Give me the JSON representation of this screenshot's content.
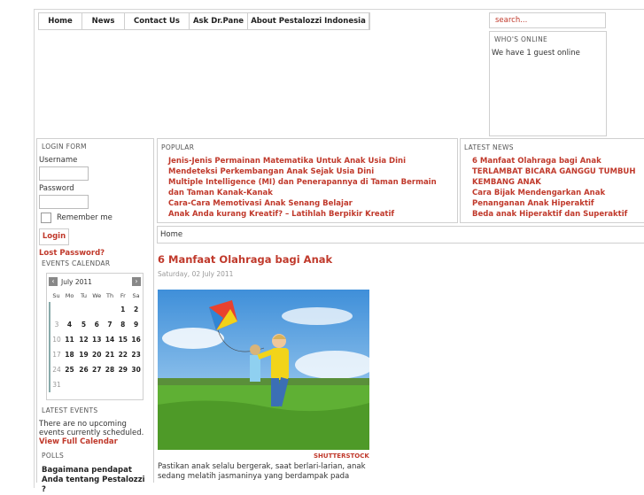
{
  "nav": {
    "items": [
      "Home",
      "News",
      "Contact Us",
      "Ask Dr.Pane",
      "About Pestalozzi Indonesia"
    ]
  },
  "search": {
    "placeholder": "search..."
  },
  "whos_online": {
    "title": "WHO'S ONLINE",
    "text": "We have 1 guest online"
  },
  "login": {
    "title": "LOGIN FORM",
    "username_label": "Username",
    "password_label": "Password",
    "remember_label": "Remember me",
    "login_button": "Login",
    "lost_password": "Lost Password?"
  },
  "calendar": {
    "title": "EVENTS CALENDAR",
    "month": "July 2011",
    "weekdays": [
      "Su",
      "Mo",
      "Tu",
      "We",
      "Th",
      "Fr",
      "Sa"
    ],
    "weeks": [
      [
        "",
        "",
        "",
        "",
        "",
        "1",
        "2"
      ],
      [
        "3",
        "4",
        "5",
        "6",
        "7",
        "8",
        "9"
      ],
      [
        "10",
        "11",
        "12",
        "13",
        "14",
        "15",
        "16"
      ],
      [
        "17",
        "18",
        "19",
        "20",
        "21",
        "22",
        "23"
      ],
      [
        "24",
        "25",
        "26",
        "27",
        "28",
        "29",
        "30"
      ],
      [
        "31",
        "",
        "",
        "",
        "",
        "",
        ""
      ]
    ]
  },
  "latest_events": {
    "title": "LATEST EVENTS",
    "text": "There are no upcoming events currently scheduled.",
    "link": "View Full Calendar"
  },
  "polls": {
    "title": "POLLS",
    "question": "Bagaimana pendapat Anda tentang Pestalozzi ?"
  },
  "popular": {
    "title": "POPULAR",
    "items": [
      "Jenis-Jenis Permainan Matematika Untuk Anak Usia Dini",
      "Mendeteksi Perkembangan Anak Sejak Usia Dini",
      "Multiple Intelligence (MI) dan Penerapannya di Taman Bermain dan Taman Kanak-Kanak",
      "Cara-Cara Memotivasi Anak Senang Belajar",
      "Anak Anda kurang Kreatif? – Latihlah Berpikir Kreatif"
    ]
  },
  "latest_news": {
    "title": "LATEST NEWS",
    "items": [
      "6 Manfaat Olahraga bagi Anak",
      "TERLAMBAT BICARA GANGGU TUMBUH KEMBANG ANAK",
      "Cara Bijak Mendengarkan Anak",
      "Penanganan Anak Hiperaktif",
      "Beda anak Hiperaktif dan Superaktif"
    ]
  },
  "breadcrumb": "Home",
  "article": {
    "title": "6 Manfaat Olahraga bagi Anak",
    "date": "Saturday, 02 July 2011",
    "image_credit": "SHUTTERSTOCK",
    "body": "Pastikan anak selalu bergerak, saat berlari-larian, anak sedang melatih jasmaninya yang berdampak pada"
  }
}
